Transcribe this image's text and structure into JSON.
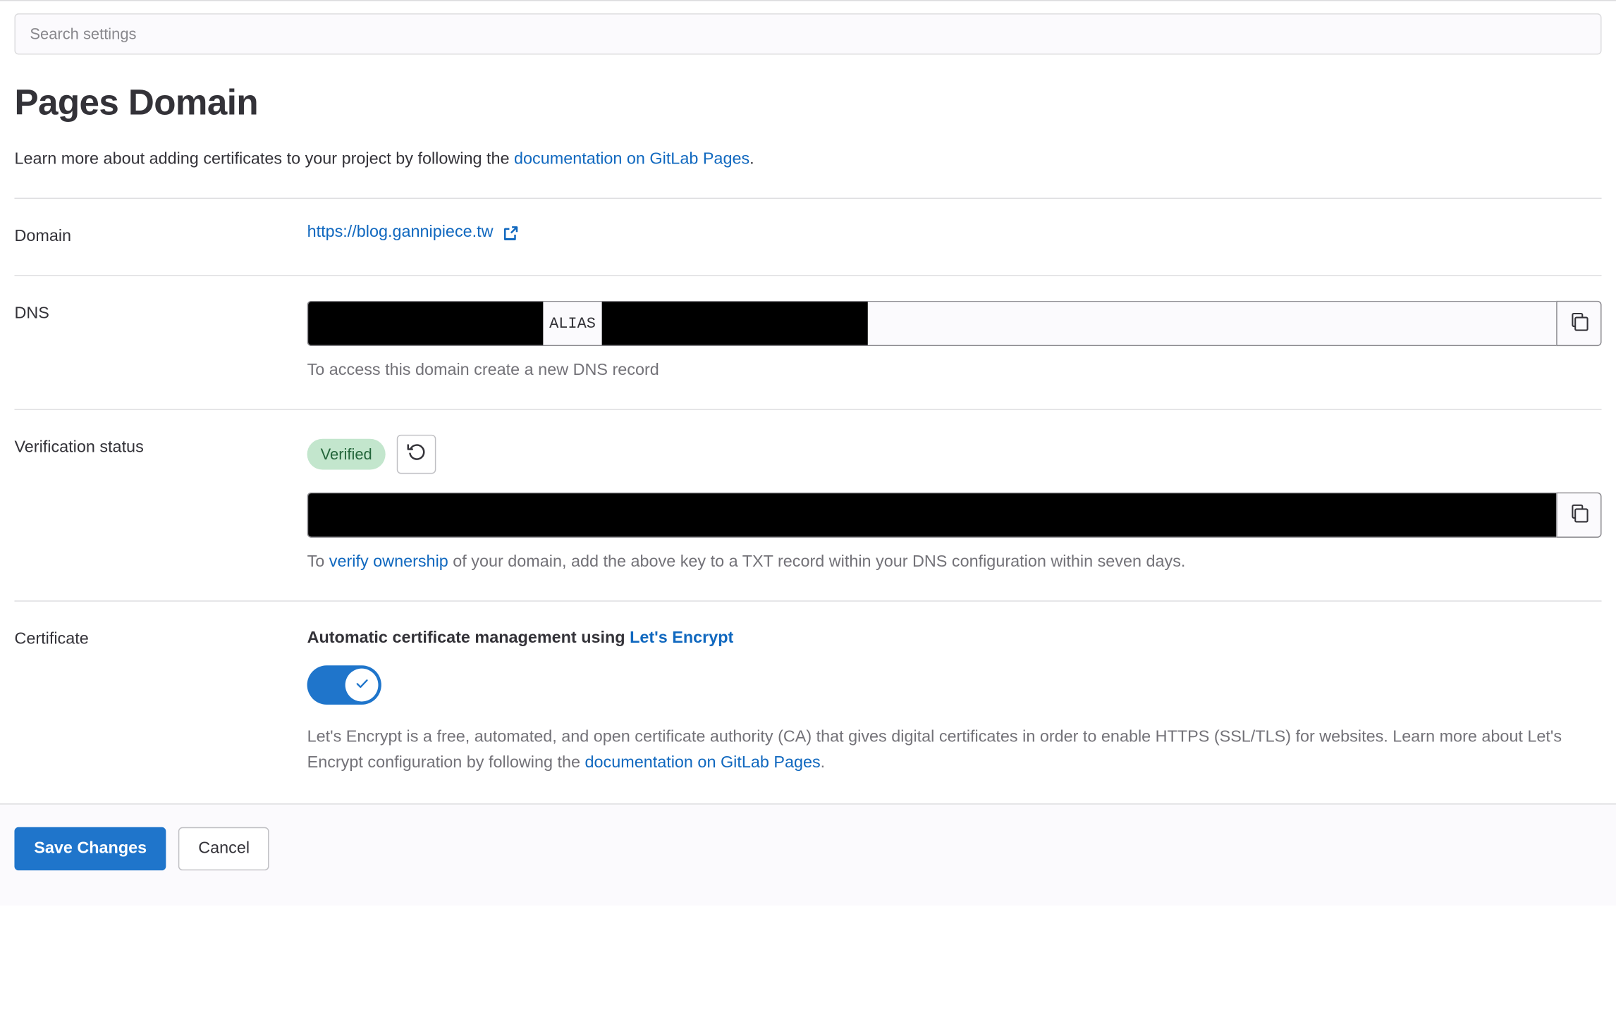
{
  "search": {
    "placeholder": "Search settings",
    "value": ""
  },
  "header": {
    "title": "Pages Domain",
    "lede_before": "Learn more about adding certificates to your project by following the ",
    "lede_link": "documentation on GitLab Pages",
    "lede_after": "."
  },
  "rows": {
    "domain": {
      "label": "Domain",
      "url_text": "https://blog.gannipiece.tw",
      "external_icon": "external-link-icon"
    },
    "dns": {
      "label": "DNS",
      "record_type": "ALIAS",
      "redacted_left": "",
      "redacted_right": "",
      "help": "To access this domain create a new DNS record",
      "copy_icon": "copy-to-clipboard-icon"
    },
    "verification": {
      "label": "Verification status",
      "badge": "Verified",
      "retry_icon": "retry-icon",
      "redacted_key": "",
      "copy_icon": "copy-to-clipboard-icon",
      "help_before": "To ",
      "help_link": "verify ownership",
      "help_after": " of your domain, add the above key to a TXT record within your DNS configuration within seven days."
    },
    "certificate": {
      "label": "Certificate",
      "title_before": "Automatic certificate management using ",
      "title_link": "Let's Encrypt",
      "toggle_state": "on",
      "toggle_icon": "check-icon",
      "description_before": "Let's Encrypt is a free, automated, and open certificate authority (CA) that gives digital certificates in order to enable HTTPS (SSL/TLS) for websites. Learn more about Let's Encrypt configuration by following the ",
      "description_link": "documentation on GitLab Pages",
      "description_after": "."
    }
  },
  "footer": {
    "save_label": "Save Changes",
    "cancel_label": "Cancel"
  },
  "colors": {
    "link": "#1068bf",
    "primary": "#1f75cb",
    "badge_bg": "#c3e6cd",
    "badge_text": "#24663b",
    "muted_text": "#737278",
    "border": "#dcdcde"
  }
}
